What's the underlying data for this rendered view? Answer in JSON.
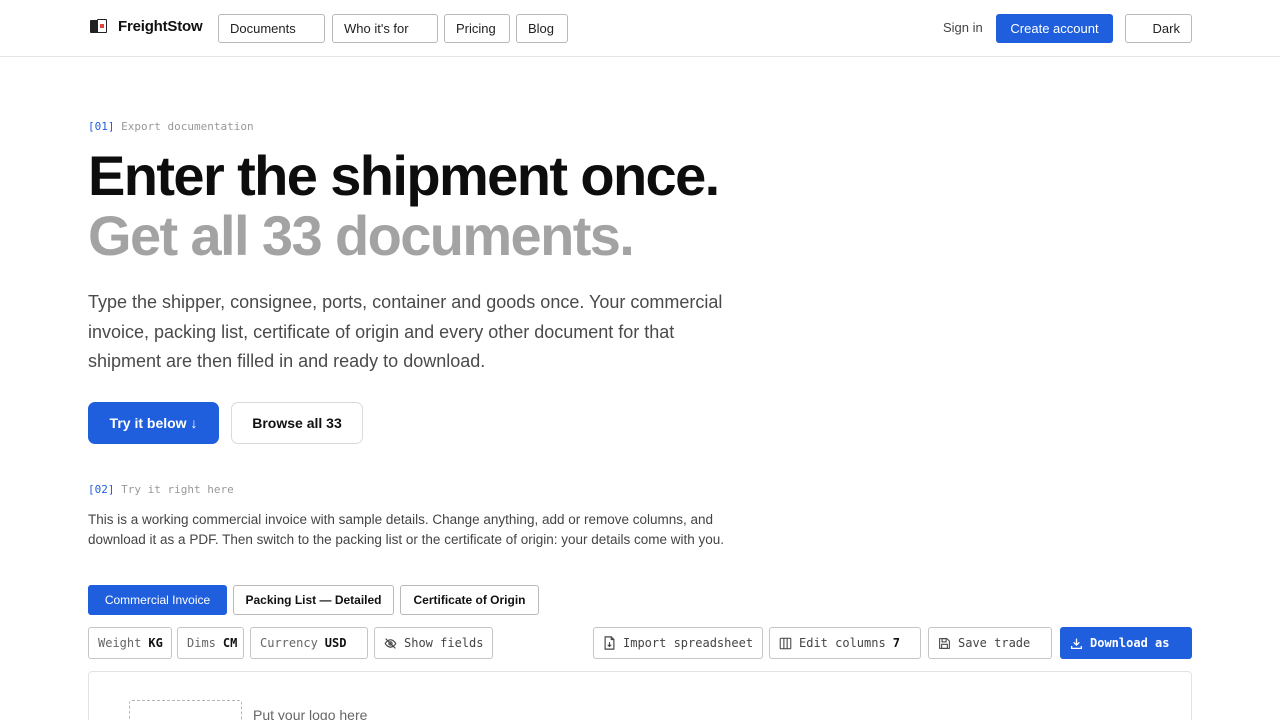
{
  "brand": {
    "name": "FreightStow"
  },
  "nav": {
    "items": [
      "Documents",
      "Who it's for",
      "Pricing",
      "Blog"
    ],
    "signin": "Sign in",
    "create_account": "Create account",
    "theme_toggle": "Dark"
  },
  "hero": {
    "eyebrow_num": "[01]",
    "eyebrow_text": "Export documentation",
    "headline_1": "Enter the shipment once.",
    "headline_2": "Get all 33 documents.",
    "lede": "Type the shipper, consignee, ports, container and goods once. Your commercial invoice, packing list, certificate of origin and every other document for that shipment are then filled in and ready to download.",
    "primary_cta": "Try it below ↓",
    "secondary_cta": "Browse all 33"
  },
  "demo": {
    "eyebrow_num": "[02]",
    "eyebrow_text": "Try it right here",
    "description": "This is a working commercial invoice with sample details. Change anything, add or remove columns, and download it as a PDF. Then switch to the packing list or the certificate of origin: your details come with you.",
    "tabs": [
      {
        "label": "Commercial Invoice",
        "active": true
      },
      {
        "label": "Packing List — Detailed",
        "active": false
      },
      {
        "label": "Certificate of Origin",
        "active": false
      }
    ],
    "toolbar": {
      "weight_label": "Weight",
      "weight_value": "KG",
      "dims_label": "Dims",
      "dims_value": "CM",
      "currency_label": "Currency",
      "currency_value": "USD",
      "show_fields": "Show fields",
      "import": "Import spreadsheet",
      "edit_columns": "Edit columns",
      "edit_columns_count": "7",
      "save_trade": "Save trade",
      "download": "Download as"
    },
    "logo_hint": "Put your logo here"
  },
  "colors": {
    "accent": "#1f5fde",
    "muted_headline": "#a3a3a3"
  },
  "icons": [
    "eye-off-icon",
    "file-import-icon",
    "columns-icon",
    "save-icon",
    "download-icon"
  ]
}
